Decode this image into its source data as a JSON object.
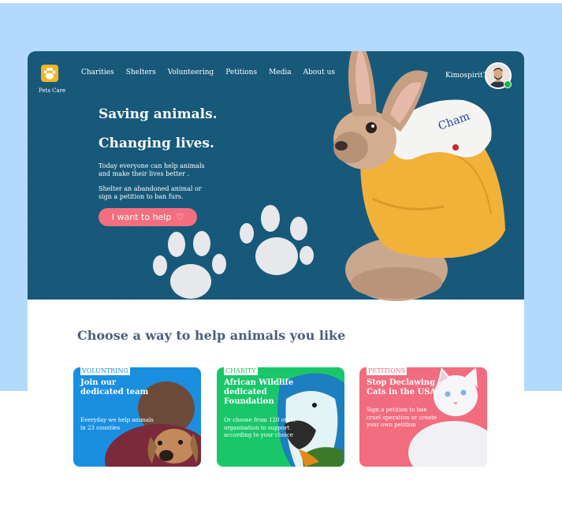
{
  "brand": {
    "name": "Pets Care",
    "logo_color": "#f2b526",
    "logo_icon": "paw-icon"
  },
  "nav": {
    "items": [
      "Charities",
      "Shelters",
      "Volunteering",
      "Petitions",
      "Media",
      "About us"
    ]
  },
  "user": {
    "name": "Kimospirit77",
    "status": "online",
    "status_color": "#1fb34a"
  },
  "hero": {
    "headline_1": "Saving animals.",
    "headline_2": "Changing lives.",
    "paragraph_1": "Today everyone can help animals and make their lives better .",
    "paragraph_2": "Shelter an abandoned animal or sign a petition to ban furs.",
    "cta_label": "I want to help",
    "cta_icon": "heart-icon",
    "background_color": "#16587a",
    "cta_color": "#f36f7f"
  },
  "section": {
    "title": "Choose a way to help animals you like"
  },
  "tiles": [
    {
      "tag": "VOLUNTRING",
      "title": "Join our dedicated team",
      "description": "Everyday we help animals in 23 counties",
      "color": "#1a8fe0"
    },
    {
      "tag": "CHARITY",
      "title": "African Wildlife dedicated Foundation",
      "description": "Or choose from 120 other organisation to support according to your choice",
      "color": "#19c76a"
    },
    {
      "tag": "PETITIONS",
      "title": "Stop Declawing Cats in the USA",
      "description": "Sign a petition to ban cruel operation or create your own petition",
      "color": "#f16c7f"
    }
  ],
  "colors": {
    "page_band": "#b3dafd",
    "section_title": "#4b5e78"
  }
}
